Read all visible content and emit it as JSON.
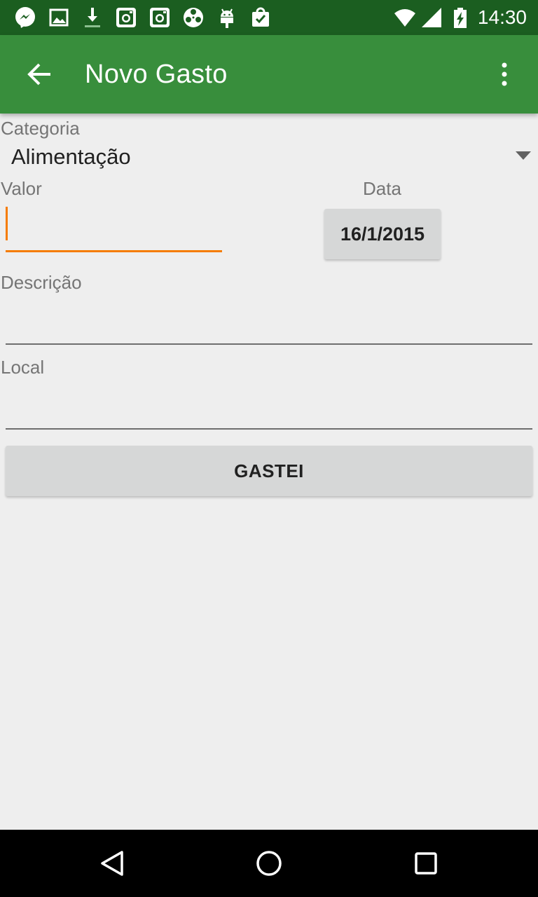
{
  "status_bar": {
    "time": "14:30",
    "notification_icons": [
      "messenger-icon",
      "image-icon",
      "download-icon",
      "instagram-icon",
      "instagram-icon",
      "film-reel-icon",
      "android-icon",
      "shopping-bag-icon"
    ],
    "system_icons": [
      "wifi-icon",
      "signal-icon",
      "battery-charging-icon"
    ]
  },
  "toolbar": {
    "title": "Novo Gasto",
    "back_icon": "arrow-back-icon",
    "menu_icon": "more-vert-icon"
  },
  "form": {
    "categoria_label": "Categoria",
    "categoria_value": "Alimentação",
    "valor_label": "Valor",
    "valor_value": "",
    "data_label": "Data",
    "data_value": "16/1/2015",
    "descricao_label": "Descrição",
    "descricao_value": "",
    "local_label": "Local",
    "local_value": "",
    "submit_label": "GASTEI"
  },
  "colors": {
    "status_bar": "#1b5e20",
    "toolbar": "#388e3c",
    "accent": "#f57c00",
    "background": "#eeeeee",
    "button": "#d6d7d7"
  },
  "nav_bar": {
    "buttons": [
      "back-triangle-icon",
      "home-circle-icon",
      "recents-square-icon"
    ]
  }
}
